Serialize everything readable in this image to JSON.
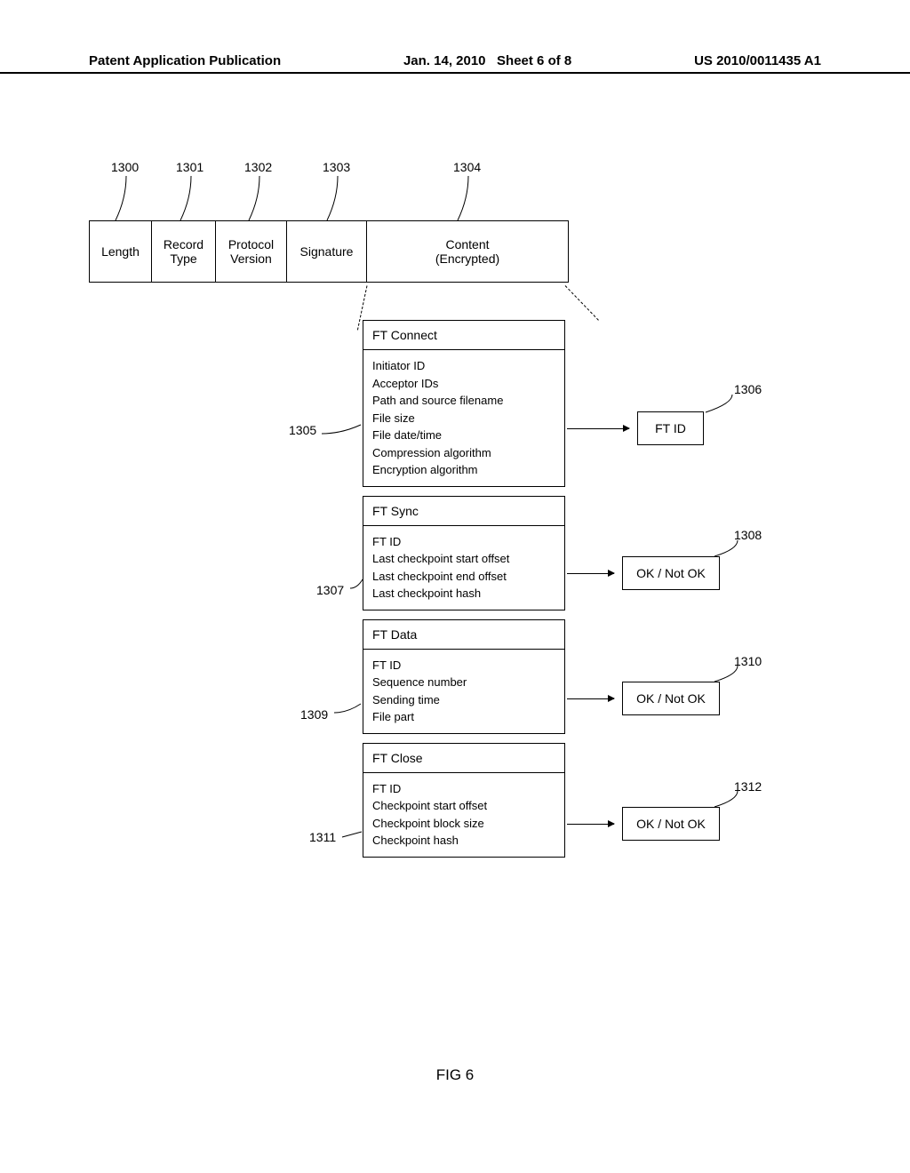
{
  "header": {
    "publication": "Patent Application Publication",
    "date": "Jan. 14, 2010",
    "sheet": "Sheet 6 of 8",
    "pubnum": "US 2010/0011435 A1"
  },
  "record": {
    "length": "Length",
    "type": "Record\nType",
    "protocol": "Protocol\nVersion",
    "signature": "Signature",
    "content": "Content\n(Encrypted)"
  },
  "refs": {
    "r1300": "1300",
    "r1301": "1301",
    "r1302": "1302",
    "r1303": "1303",
    "r1304": "1304",
    "r1305": "1305",
    "r1306": "1306",
    "r1307": "1307",
    "r1308": "1308",
    "r1309": "1309",
    "r1310": "1310",
    "r1311": "1311",
    "r1312": "1312"
  },
  "blocks": {
    "b1": {
      "title": "FT Connect",
      "body": "Initiator ID\nAcceptor IDs\nPath and source filename\nFile size\nFile date/time\nCompression algorithm\nEncryption algorithm"
    },
    "b2": {
      "title": "FT Sync",
      "body": "FT ID\nLast checkpoint start offset\nLast checkpoint end offset\nLast checkpoint hash"
    },
    "b3": {
      "title": "FT Data",
      "body": "FT ID\nSequence number\nSending time\nFile part"
    },
    "b4": {
      "title": "FT Close",
      "body": "FT ID\nCheckpoint start offset\nCheckpoint block size\nCheckpoint hash"
    }
  },
  "responses": {
    "resp1": "FT ID",
    "resp2": "OK / Not OK",
    "resp3": "OK / Not OK",
    "resp4": "OK / Not OK"
  },
  "caption": "FIG 6"
}
